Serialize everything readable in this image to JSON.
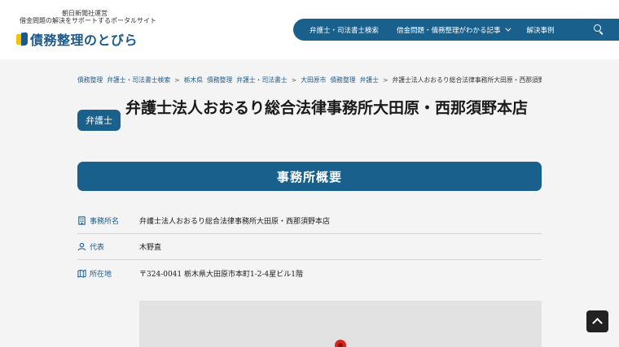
{
  "header": {
    "tagline_line1": "朝日新聞社運営",
    "tagline_line2": "借金問題の解決をサポートするポータルサイト",
    "logo_text": "債務整理のとびら",
    "nav": [
      {
        "label": "弁護士・司法書士検索",
        "has_dropdown": false
      },
      {
        "label": "借金問題・債務整理がわかる記事",
        "has_dropdown": true
      },
      {
        "label": "解決事例",
        "has_dropdown": false
      }
    ],
    "search_icon": "search-icon",
    "accent_color": "#19608c"
  },
  "breadcrumb": {
    "items": [
      "債務整理",
      "弁護士・司法書士検索",
      "栃木県",
      "債務整理",
      "弁護士・司法書士",
      "大田原市",
      "債務整理",
      "弁護士"
    ],
    "separator": ">",
    "current": "弁護士法人おおるり総合法律事務所大田原・西那須野本店"
  },
  "title": {
    "badge": "弁護士",
    "text": "弁護士法人おおるり総合法律事務所大田原・西那須野本店"
  },
  "section": {
    "heading": "事務所概要"
  },
  "info": [
    {
      "icon": "building-icon",
      "label": "事務所名",
      "value": "弁護士法人おおるり総合法律事務所大田原・西那須野本店"
    },
    {
      "icon": "person-icon",
      "label": "代表",
      "value": "木野直"
    },
    {
      "icon": "map-icon",
      "label": "所在地",
      "value": "〒324-0041 栃木県大田原市本町1-2-4星ビル1階"
    }
  ],
  "map": {
    "marker_icon": "map-pin-icon"
  },
  "page_top": {
    "icon": "arrow-up-icon"
  }
}
